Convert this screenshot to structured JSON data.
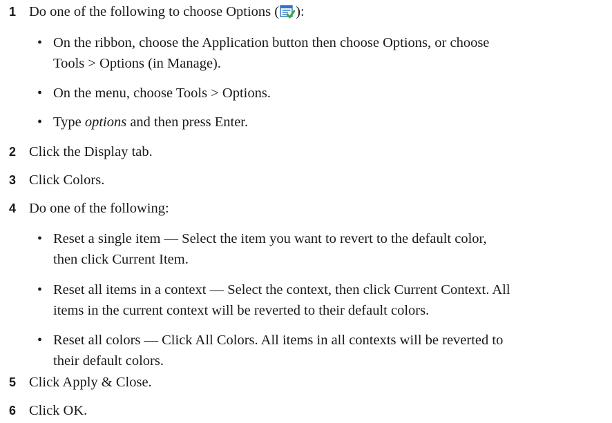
{
  "steps": [
    {
      "number": "1",
      "text_before": "Do one of the following to choose Options (",
      "icon": "options-icon",
      "text_after": "):",
      "bullets": [
        {
          "line1": "On the ribbon, choose the Application button then choose Options, or choose",
          "line2": "Tools > Options (in Manage)."
        },
        {
          "line1": "On the menu, choose Tools > Options."
        },
        {
          "em": "options",
          "rest": " and then press Enter.",
          "prefix": "Type "
        }
      ]
    },
    {
      "number": "2",
      "text": "Click the Display tab."
    },
    {
      "number": "3",
      "text": "Click Colors."
    },
    {
      "number": "4",
      "text": "Do one of the following:",
      "bullets": [
        {
          "line1": "Reset a single item — Select the item you want to revert to the default color,",
          "line2": "then click Current Item."
        },
        {
          "line1": "Reset all items in a context — Select the context, then click Current Context. All",
          "line2": "items in the current context will be reverted to their default colors."
        },
        {
          "line1": "Reset all colors — Click All Colors. All items in all contexts will be reverted to",
          "line2": "their default colors."
        }
      ]
    },
    {
      "number": "5",
      "text": "Click Apply & Close."
    },
    {
      "number": "6",
      "text": "Click OK."
    }
  ],
  "bullet_glyph": "•",
  "colors": {
    "text": "#1a1a1a",
    "icon_blue": "#2f78c4",
    "icon_check": "#3aa845"
  }
}
